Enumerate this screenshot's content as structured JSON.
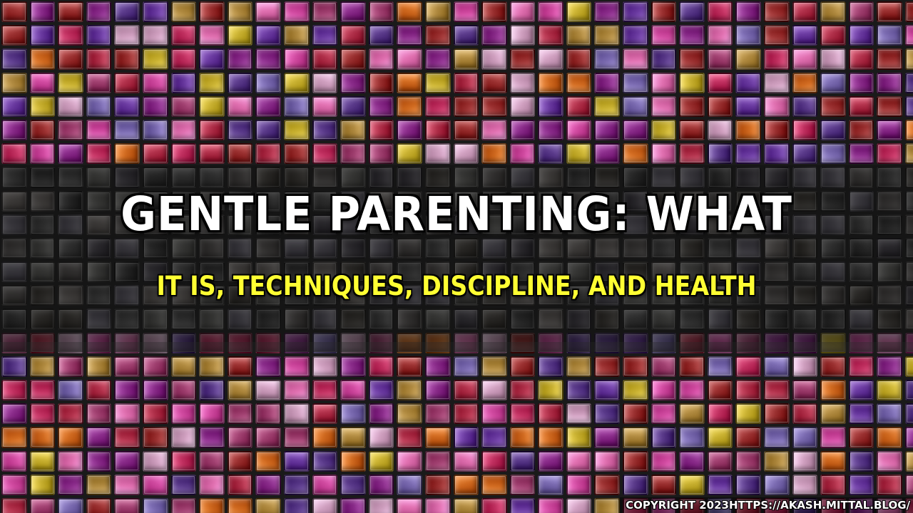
{
  "title": {
    "line1": "GENTLE PARENTING: WHAT",
    "line2": "IT IS, TECHNIQUES, DISCIPLINE, AND HEALTH"
  },
  "footer": {
    "copyright": "COPYRIGHT 2023HTTPS://AKASH.MITTAL.BLOG/"
  },
  "colors": {
    "title_primary": "#ffffff",
    "title_secondary": "#ffff33",
    "tile_palette": [
      "#b0304a",
      "#8a2c8a",
      "#d04aa0",
      "#6a3aa0",
      "#c8b030",
      "#d06a20",
      "#9a3030",
      "#e070b0",
      "#5a3a8a",
      "#b08a40",
      "#c03060",
      "#7a6ab0",
      "#d0a0c0",
      "#a04070"
    ],
    "tile_palette_muted": [
      "#555555",
      "#6a6a66",
      "#3e3e3e",
      "#7a7470",
      "#4a4650",
      "#5e5a58",
      "#6e6a78",
      "#48443e"
    ]
  }
}
